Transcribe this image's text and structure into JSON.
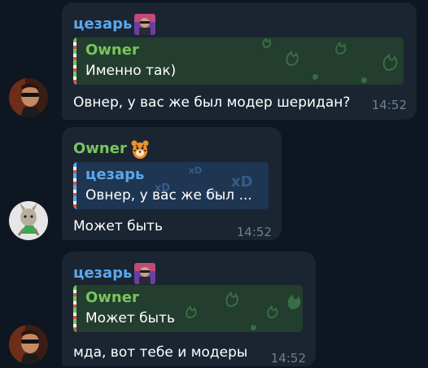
{
  "colors": {
    "background": "#0e1621",
    "bubble": "#1b2531",
    "name_blue": "#5aa9f0",
    "name_green": "#77c65d",
    "time": "#6d7f8f"
  },
  "messages": [
    {
      "sender": "цезарь",
      "sender_emoji": "portrait-emoji",
      "reply": {
        "name": "Owner",
        "text": "Именно так)"
      },
      "text": "Овнер, у вас же был модер шеридан?",
      "time": "14:52"
    },
    {
      "sender": "Owner",
      "sender_emoji": "tiger-emoji",
      "reply": {
        "name": "цезарь",
        "text": "Овнер, у вас же был ..."
      },
      "text": "Может быть",
      "time": "14:52"
    },
    {
      "sender": "цезарь",
      "sender_emoji": "portrait-emoji",
      "reply": {
        "name": "Owner",
        "text": "Может быть"
      },
      "text": "мда, вот тебе и модеры",
      "time": "14:52"
    }
  ],
  "quote_pattern_glyph": "xD"
}
